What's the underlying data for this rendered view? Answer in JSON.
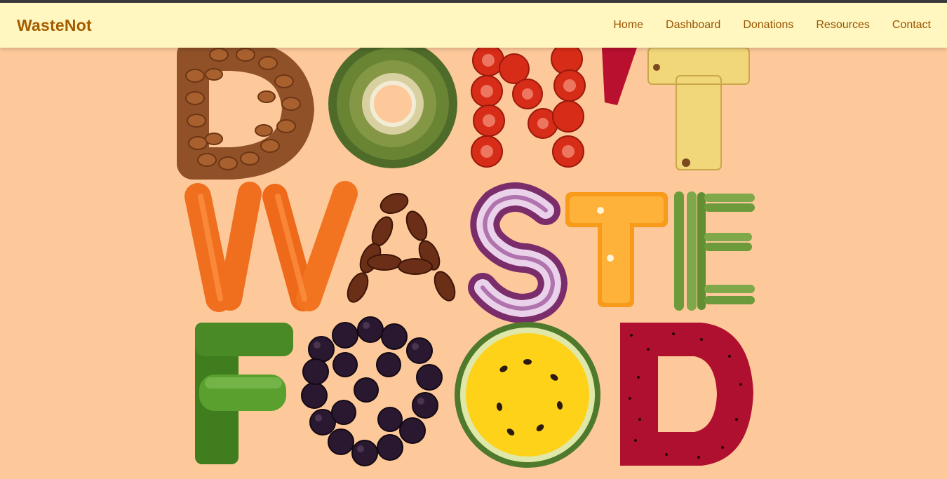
{
  "brand": "WasteNot",
  "nav": {
    "home": "Home",
    "dashboard": "Dashboard",
    "donations": "Donations",
    "resources": "Resources",
    "contact": "Contact"
  },
  "hero": {
    "image_text": "DON'T WASTE FOOD",
    "background_color": "#fdc99a"
  },
  "colors": {
    "navbar_bg": "#fff6c0",
    "brand_text": "#a45c00",
    "nav_text": "#9a5500",
    "top_strip": "#3a3a3a"
  }
}
